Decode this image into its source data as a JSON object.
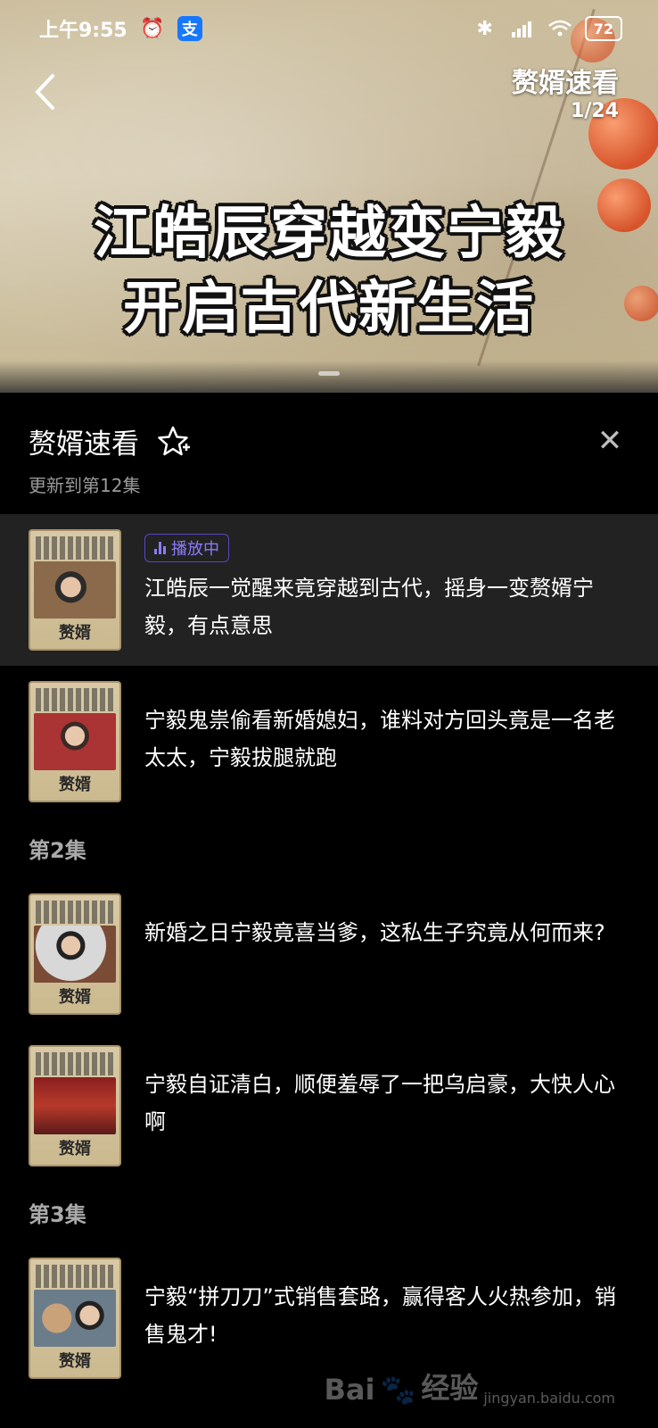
{
  "status_bar": {
    "time": "上午9:55",
    "battery": "72"
  },
  "video": {
    "title": "赘婿速看",
    "page": "1/24",
    "caption_line1": "江皓辰穿越变宁毅",
    "caption_line2": "开启古代新生活"
  },
  "sheet": {
    "title": "赘婿速看",
    "subtitle": "更新到第12集",
    "close_label": "✕",
    "now_playing": "播放中"
  },
  "list": [
    {
      "desc": "江皓辰一觉醒来竟穿越到古代，摇身一变赘婿宁毅，有点意思",
      "playing": true
    },
    {
      "desc": "宁毅鬼祟偷看新婚媳妇，谁料对方回头竟是一名老太太，宁毅拔腿就跑"
    },
    {
      "section": "第2集"
    },
    {
      "desc": "新婚之日宁毅竟喜当爹，这私生子究竟从何而来?"
    },
    {
      "desc": "宁毅自证清白，顺便羞辱了一把乌启豪，大快人心啊"
    },
    {
      "section": "第3集"
    },
    {
      "desc": "宁毅“拼刀刀”式销售套路，赢得客人火热参加，销售鬼才!"
    }
  ],
  "thumb_label": "赘婿",
  "watermark": {
    "brand": "Bai",
    "suffix": "经验",
    "url": "jingyan.baidu.com"
  },
  "colors": {
    "accent": "#8a7bff",
    "sheet_bg": "#000000",
    "active_row": "#222222"
  }
}
